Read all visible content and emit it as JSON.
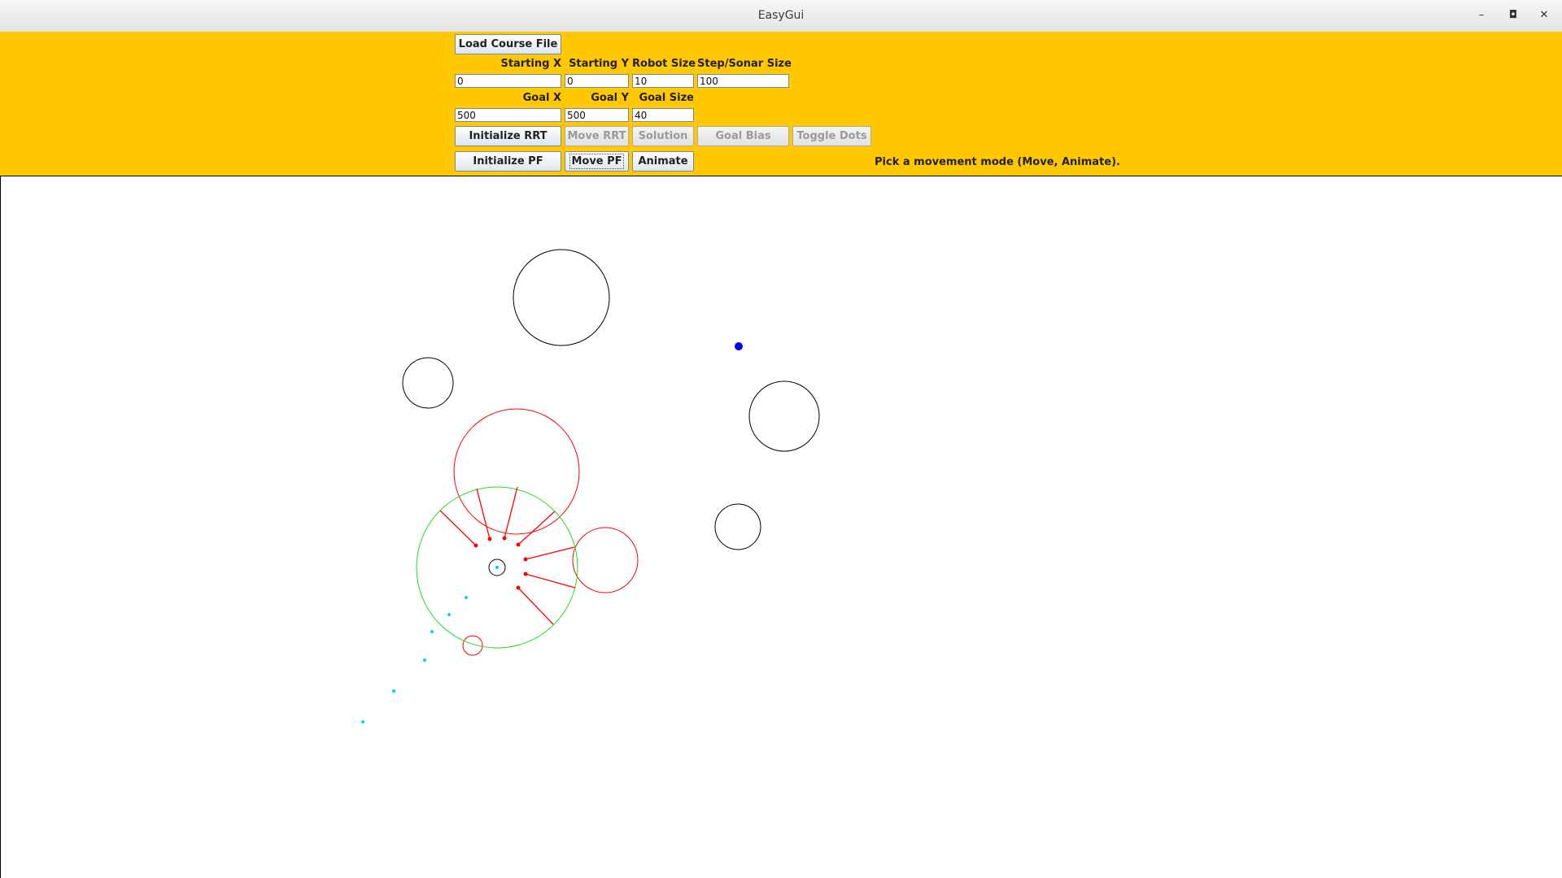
{
  "window": {
    "title": "EasyGui",
    "minimize_icon": "minimize-icon",
    "maximize_icon": "maximize-icon",
    "close_icon": "close-icon",
    "minimize_glyph": "–",
    "maximize_glyph": "◘",
    "close_glyph": "✕"
  },
  "controls": {
    "load_button": "Load Course File",
    "labels": {
      "start_x": "Starting X",
      "start_y": "Starting Y",
      "robot_size": "Robot Size",
      "step_sonar": "Step/Sonar Size",
      "goal_x": "Goal X",
      "goal_y": "Goal Y",
      "goal_size": "Goal Size"
    },
    "values": {
      "start_x": "0",
      "start_y": "0",
      "robot_size": "10",
      "step_sonar": "100",
      "goal_x": "500",
      "goal_y": "500",
      "goal_size": "40"
    },
    "buttons": {
      "init_rrt": "Initialize RRT",
      "move_rrt": "Move RRT",
      "solution": "Solution",
      "goal_bias": "Goal Bias",
      "toggle_dots": "Toggle Dots",
      "init_pf": "Initialize PF",
      "move_pf": "Move PF",
      "animate": "Animate"
    },
    "status": "Pick a movement mode (Move, Animate)."
  },
  "colors": {
    "panel": "#ffc800",
    "obstacle": "#000000",
    "detected": "#ff0000",
    "sonar": "#00e000",
    "trail": "#00e0e0",
    "goal": "#0000ff"
  }
}
